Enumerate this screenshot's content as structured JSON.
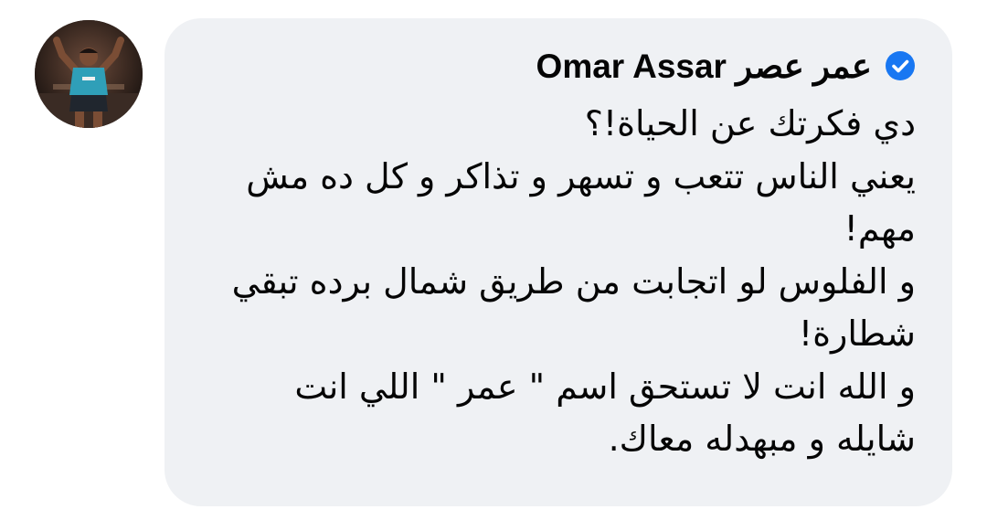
{
  "comment": {
    "author_name": "Omar Assar عمر عصر",
    "verified_icon": "verified-badge-icon",
    "colors": {
      "bubble": "#eff1f4",
      "text": "#050505",
      "verified": "#1877f2"
    },
    "lines": [
      "دي فكرتك عن الحياة!؟",
      "يعني الناس تتعب و تسهر و تذاكر و كل ده مش",
      "مهم!",
      "و الفلوس لو اتجابت من طريق شمال برده تبقي",
      "شطارة!",
      "و الله انت لا تستحق اسم \" عمر \" اللي انت",
      "شايله و مبهدله معاك."
    ]
  }
}
